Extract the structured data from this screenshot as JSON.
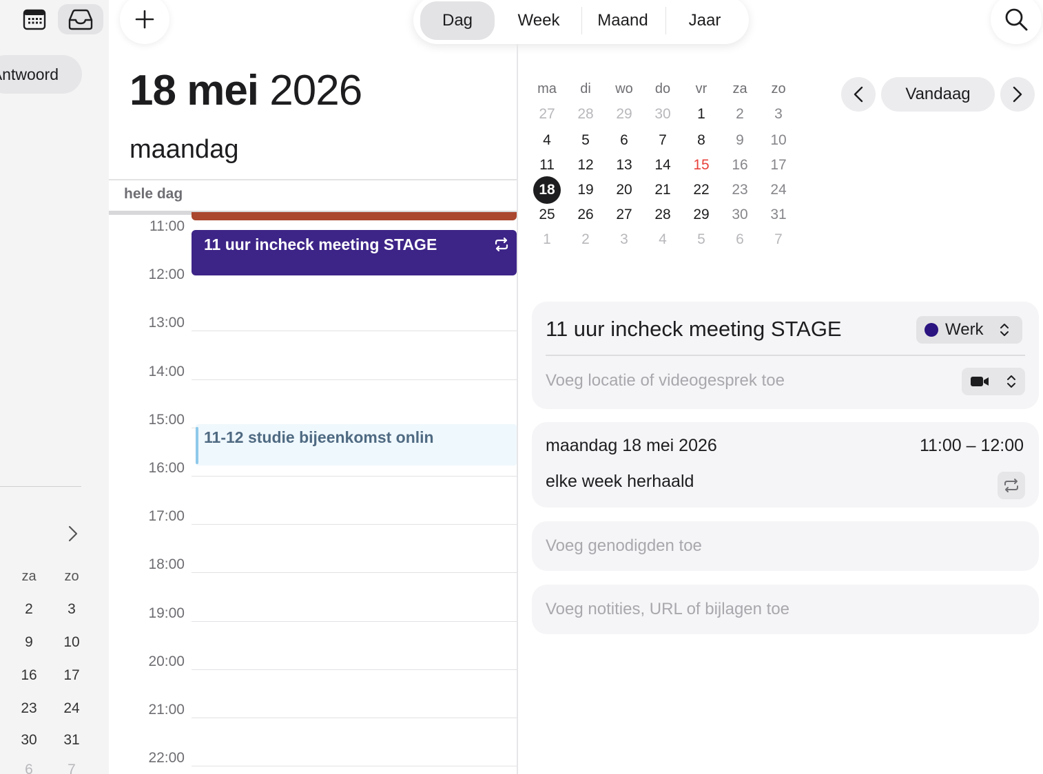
{
  "sidebar": {
    "pill_label": "Antwoord",
    "mini_calendar": {
      "headers": [
        "za",
        "zo"
      ],
      "rows": [
        [
          "2",
          "3"
        ],
        [
          "9",
          "10"
        ],
        [
          "16",
          "17"
        ],
        [
          "23",
          "24"
        ],
        [
          "30",
          "31"
        ],
        [
          "6",
          "7"
        ]
      ]
    }
  },
  "toolbar": {
    "views": [
      "Dag",
      "Week",
      "Maand",
      "Jaar"
    ],
    "active_view": "Dag"
  },
  "day": {
    "day_month": "18 mei",
    "year": "2026",
    "weekday": "maandag",
    "all_day_label": "hele dag",
    "hours": [
      "11:00",
      "12:00",
      "13:00",
      "14:00",
      "15:00",
      "16:00",
      "17:00",
      "18:00",
      "19:00",
      "20:00",
      "21:00",
      "22:00"
    ],
    "events": {
      "stage_title": "11 uur incheck meeting STAGE",
      "studie_title": "11-12 studie bijeenkomst onlin"
    },
    "colors": {
      "stage": "#3d2487",
      "studie": "#8ec9ea",
      "red_event": "#a9472f"
    }
  },
  "mini_calendar": {
    "headers": [
      "ma",
      "di",
      "wo",
      "do",
      "vr",
      "za",
      "zo"
    ],
    "weeks": [
      [
        "27",
        "28",
        "29",
        "30",
        "1",
        "2",
        "3"
      ],
      [
        "4",
        "5",
        "6",
        "7",
        "8",
        "9",
        "10"
      ],
      [
        "11",
        "12",
        "13",
        "14",
        "15",
        "16",
        "17"
      ],
      [
        "18",
        "19",
        "20",
        "21",
        "22",
        "23",
        "24"
      ],
      [
        "25",
        "26",
        "27",
        "28",
        "29",
        "30",
        "31"
      ],
      [
        "1",
        "2",
        "3",
        "4",
        "5",
        "6",
        "7"
      ]
    ],
    "selected": "18",
    "today_red": "15",
    "today_button": "Vandaag"
  },
  "detail": {
    "title": "11 uur incheck meeting STAGE",
    "calendar_name": "Werk",
    "calendar_color": "#2b1380",
    "location_placeholder": "Voeg locatie of videogesprek toe",
    "date": "maandag 18 mei 2026",
    "time": "11:00 – 12:00",
    "repeat": "elke week herhaald",
    "invitees_placeholder": "Voeg genodigden toe",
    "notes_placeholder": "Voeg notities, URL of bijlagen toe"
  }
}
